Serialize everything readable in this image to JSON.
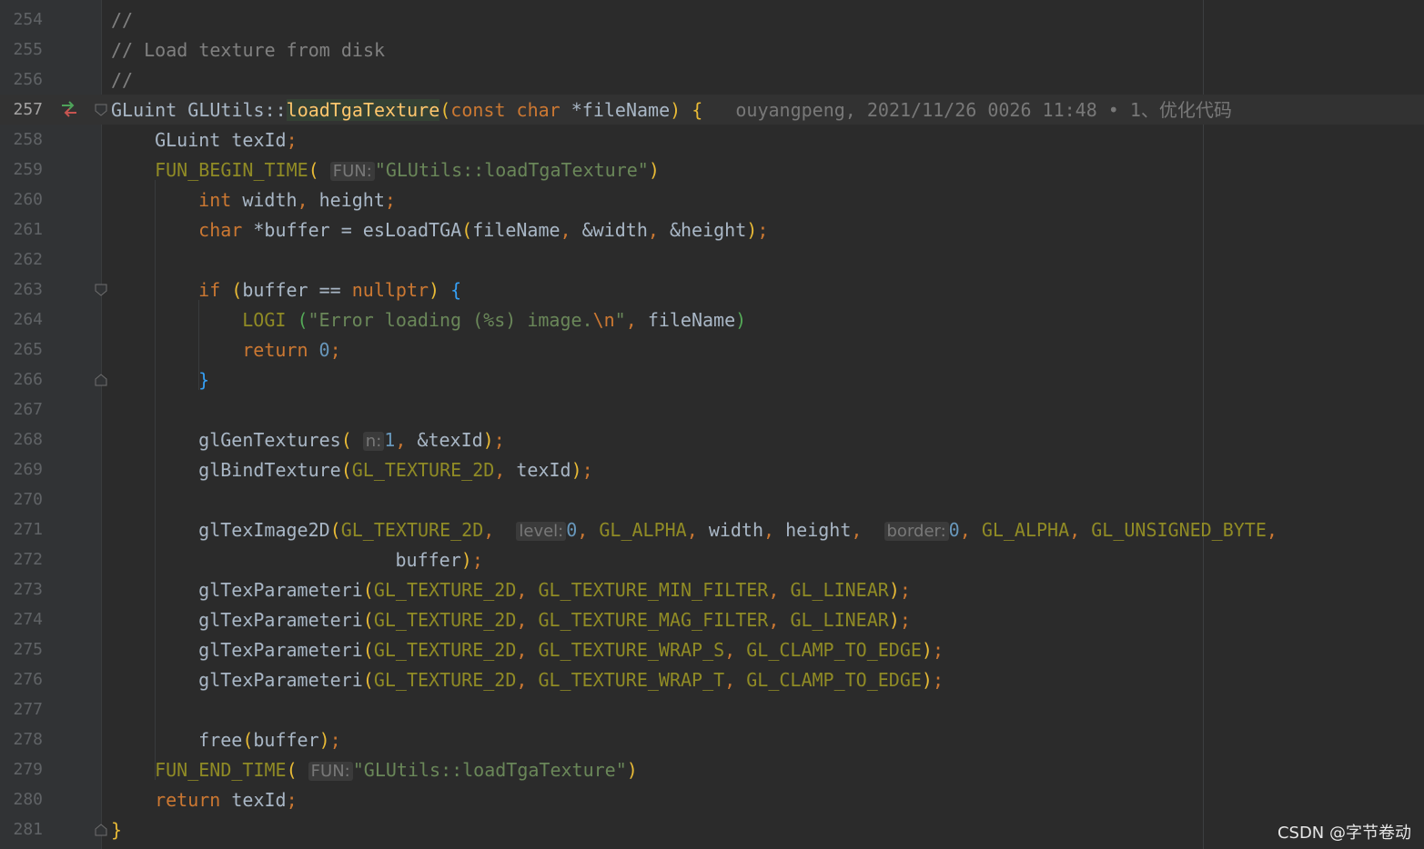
{
  "editor": {
    "lines": [
      {
        "n": "254",
        "text": "//"
      },
      {
        "n": "255",
        "text": "// Load texture from disk"
      },
      {
        "n": "256",
        "text": "//"
      },
      {
        "n": "257",
        "text": "GLuint GLUtils::loadTgaTexture(const char *fileName) {",
        "blame": "ouyangpeng, 2021/11/26 0026 11:48 • 1、优化代码"
      },
      {
        "n": "258",
        "text": "GLuint texId;"
      },
      {
        "n": "259",
        "text": "FUN_BEGIN_TIME( FUN: \"GLUtils::loadTgaTexture\")"
      },
      {
        "n": "260",
        "text": "int width, height;"
      },
      {
        "n": "261",
        "text": "char *buffer = esLoadTGA(fileName, &width, &height);"
      },
      {
        "n": "262",
        "text": ""
      },
      {
        "n": "263",
        "text": "if (buffer == nullptr) {"
      },
      {
        "n": "264",
        "text": "LOGI (\"Error loading (%s) image.\\n\", fileName)"
      },
      {
        "n": "265",
        "text": "return 0;"
      },
      {
        "n": "266",
        "text": "}"
      },
      {
        "n": "267",
        "text": ""
      },
      {
        "n": "268",
        "text": "glGenTextures( n: 1, &texId);"
      },
      {
        "n": "269",
        "text": "glBindTexture(GL_TEXTURE_2D, texId);"
      },
      {
        "n": "270",
        "text": ""
      },
      {
        "n": "271",
        "text": "glTexImage2D(GL_TEXTURE_2D,  level: 0, GL_ALPHA, width, height,  border: 0, GL_ALPHA, GL_UNSIGNED_BYTE,"
      },
      {
        "n": "272",
        "text": "buffer);"
      },
      {
        "n": "273",
        "text": "glTexParameteri(GL_TEXTURE_2D, GL_TEXTURE_MIN_FILTER, GL_LINEAR);"
      },
      {
        "n": "274",
        "text": "glTexParameteri(GL_TEXTURE_2D, GL_TEXTURE_MAG_FILTER, GL_LINEAR);"
      },
      {
        "n": "275",
        "text": "glTexParameteri(GL_TEXTURE_2D, GL_TEXTURE_WRAP_S, GL_CLAMP_TO_EDGE);"
      },
      {
        "n": "276",
        "text": "glTexParameteri(GL_TEXTURE_2D, GL_TEXTURE_WRAP_T, GL_CLAMP_TO_EDGE);"
      },
      {
        "n": "277",
        "text": ""
      },
      {
        "n": "278",
        "text": "free(buffer);"
      },
      {
        "n": "279",
        "text": "FUN_END_TIME( FUN: \"GLUtils::loadTgaTexture\")"
      },
      {
        "n": "280",
        "text": "return texId;"
      },
      {
        "n": "281",
        "text": "}"
      }
    ],
    "current_line": "257",
    "hints": {
      "fun": "FUN:",
      "n": "n:",
      "level": "level:",
      "border": "border:"
    },
    "icons": {
      "gutter_marker": "implements-arrows-icon",
      "fold_open": "fold-open-icon",
      "fold_close": "fold-close-icon"
    },
    "colors": {
      "background": "#2b2b2b",
      "keyword": "#cc7832",
      "string": "#6a8759",
      "number": "#6897bb",
      "macro": "#908b25",
      "highlight_function": "#ffc66d"
    }
  },
  "watermark": "CSDN @字节卷动"
}
